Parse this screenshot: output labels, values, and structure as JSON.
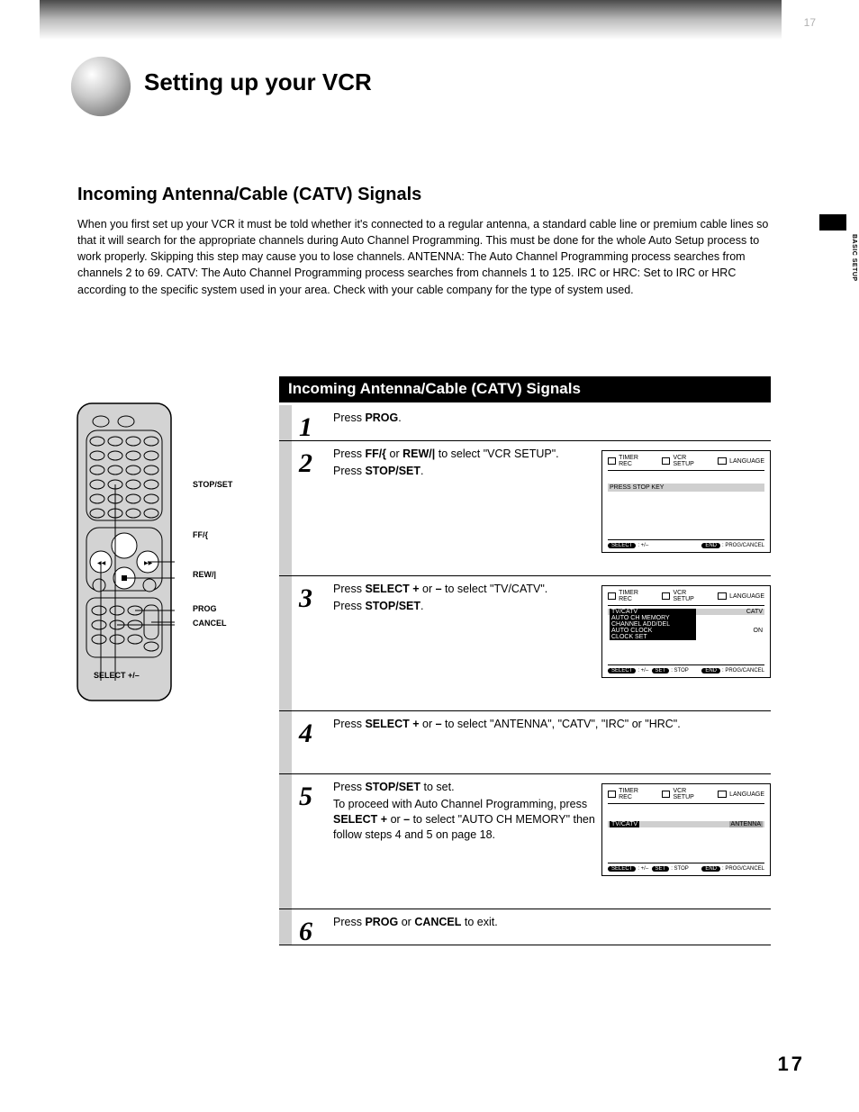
{
  "page": {
    "chapter_title": "Setting up your VCR",
    "section_title": "Incoming Antenna/Cable (CATV) Signals",
    "intro": "When you first set up your VCR it must be told whether it's connected to a regular antenna, a standard cable line or premium cable lines so that it will search for the appropriate channels during Auto Channel Programming. This must be done for the whole Auto Setup process to work properly. Skipping this step may cause you to lose channels. ANTENNA: The Auto Channel Programming process searches from channels 2 to 69. CATV: The Auto Channel Programming process searches from channels 1 to 125. IRC or HRC: Set to IRC or HRC according to the specific system used in your area. Check with your cable company for the type of system used.",
    "remote_labels": {
      "stop_set": "STOP/SET",
      "ff": "FF/{",
      "rew": "REW/|",
      "prog": "PROG",
      "cancel": "CANCEL",
      "select": "SELECT +/–"
    },
    "proc_header": "Incoming Antenna/Cable (CATV) Signals",
    "steps": [
      {
        "num": "1",
        "text_html": "Press <b>PROG</b>."
      },
      {
        "num": "2",
        "text_html": "Press <b>FF/{</b> or <b>REW/|</b> to select \"VCR SETUP\".",
        "sub_html": "Press <b>STOP/SET</b>.",
        "osd": 1
      },
      {
        "num": "3",
        "text_html": "Press <b>SELECT +</b> or <b>–</b> to select \"TV/CATV\".",
        "sub_html": "Press <b>STOP/SET</b>.",
        "osd": 2
      },
      {
        "num": "4",
        "text_html": "Press <b>SELECT +</b> or <b>–</b> to select \"ANTENNA\", \"CATV\", \"IRC\" or \"HRC\".",
        "osd": 0
      },
      {
        "num": "5",
        "text_html": "Press <b>STOP/SET</b> to set.",
        "sub_html": "To proceed with Auto Channel Programming, press <b>SELECT +</b> or <b>–</b> to select \"AUTO CH MEMORY\" then follow steps 4 and 5 on page 18.",
        "osd": 3
      },
      {
        "num": "6",
        "text_html": "Press <b>PROG</b> or <b>CANCEL</b> to exit.",
        "osd": 0
      }
    ],
    "osd_common": {
      "tab1": "TIMER REC",
      "tab2": "VCR SETUP",
      "tab3": "LANGUAGE",
      "select_lbl": "SELECT",
      "select_hint": ": +/–",
      "set_lbl": "SET",
      "set_hint": ": STOP",
      "end_lbl": "END",
      "end_hint": ": PROG/CANCEL"
    },
    "osd1": {
      "hint": "PRESS STOP KEY"
    },
    "osd2": {
      "rows": [
        {
          "label": "TV/CATV",
          "value": "CATV",
          "sel": true,
          "hl": true
        },
        {
          "label": "AUTO CH MEMORY",
          "value": "",
          "sel": false,
          "hl": true
        },
        {
          "label": "CHANNEL ADD/DEL",
          "value": "",
          "sel": false,
          "hl": true
        },
        {
          "label": "AUTO CLOCK",
          "value": "ON",
          "sel": false,
          "hl": true
        },
        {
          "label": "CLOCK SET",
          "value": "",
          "sel": false,
          "hl": true
        }
      ]
    },
    "osd3": {
      "row": {
        "label": "TV/CATV",
        "value": "ANTENNA"
      }
    },
    "page_number": "17",
    "vtab_text": "BASIC SETUP"
  }
}
